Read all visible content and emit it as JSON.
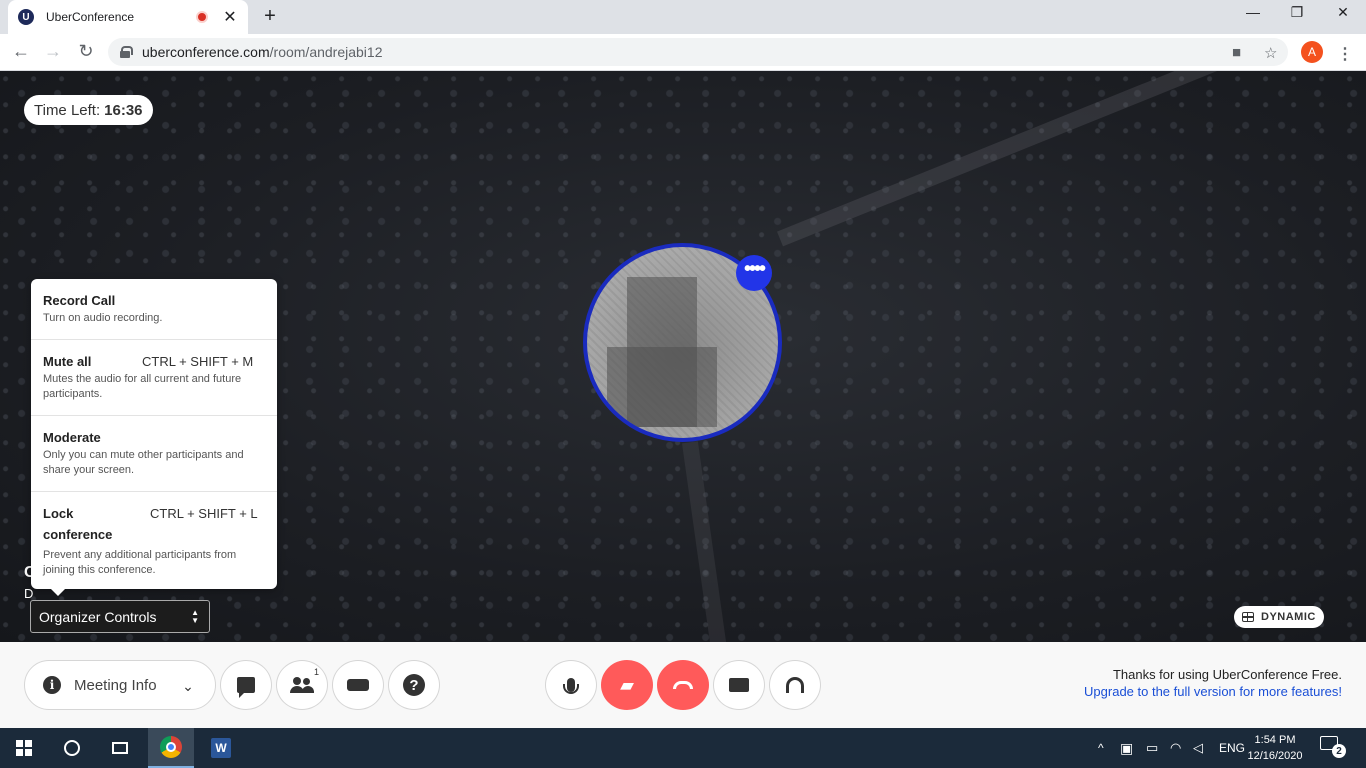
{
  "browser": {
    "tab_title": "UberConference",
    "favicon_letter": "U",
    "url_host": "uberconference.com",
    "url_path": "/room/andrejabi12",
    "profile_initial": "A",
    "icons": [
      "back-arrow-icon",
      "forward-arrow-icon",
      "reload-icon",
      "lock-icon",
      "camera-icon",
      "star-icon",
      "menu-dots-icon",
      "minimize-icon",
      "restore-icon",
      "close-icon"
    ]
  },
  "stage": {
    "time_left_label": "Time Left:",
    "time_left_value": "16:36",
    "avatar_menu_glyph": "••••",
    "dynamic_label": "DYNAMIC",
    "partial_line1": "C",
    "partial_line2": "D"
  },
  "organizer": {
    "items": [
      {
        "title": "Record Call",
        "shortcut": "",
        "description": "Turn on audio recording."
      },
      {
        "title": "Mute all",
        "shortcut": "CTRL + SHIFT + M",
        "description": "Mutes the audio for all current and future participants."
      },
      {
        "title": "Moderate",
        "shortcut": "",
        "description": "Only you can mute other participants and share your screen."
      },
      {
        "title": "Lock conference",
        "shortcut": "CTRL + SHIFT + L",
        "description": "Prevent any additional participants from joining this conference."
      }
    ],
    "select_value": "Organizer Controls"
  },
  "controls": {
    "meeting_info_label": "Meeting Info",
    "participants_count": "1",
    "promo_line1": "Thanks for using UberConference Free.",
    "promo_line2": "Upgrade to the full version for more features!",
    "accent_red": "#ff5a5a",
    "accent_blue": "#1a4fd6"
  },
  "taskbar": {
    "language": "ENG",
    "time": "1:54 PM",
    "date": "12/16/2020",
    "notification_count": "2"
  }
}
